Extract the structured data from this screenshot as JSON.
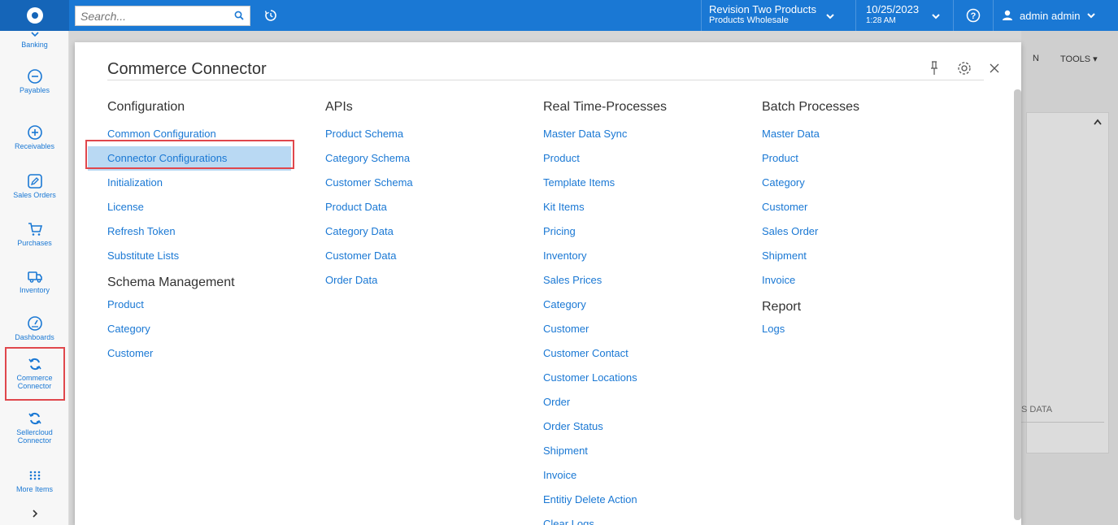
{
  "topbar": {
    "search_placeholder": "Search...",
    "branch_name": "Revision Two Products",
    "branch_sub": "Products Wholesale",
    "date": "10/25/2023",
    "time": "1:28 AM",
    "user": "admin admin"
  },
  "leftnav": {
    "items": [
      {
        "label": "Banking",
        "icon": "banking-icon"
      },
      {
        "label": "Payables",
        "icon": "minus-circle-icon"
      },
      {
        "label": "Receivables",
        "icon": "plus-circle-icon"
      },
      {
        "label": "Sales Orders",
        "icon": "pencil-icon"
      },
      {
        "label": "Purchases",
        "icon": "cart-icon"
      },
      {
        "label": "Inventory",
        "icon": "truck-icon"
      },
      {
        "label": "Dashboards",
        "icon": "gauge-icon"
      },
      {
        "label": "Commerce Connector",
        "icon": "sync-icon"
      },
      {
        "label": "Sellercloud Connector",
        "icon": "sync-icon"
      },
      {
        "label": "More Items",
        "icon": "grid-icon"
      }
    ]
  },
  "workspace": {
    "tab_partial": "N",
    "tools_label": "TOOLS",
    "data_label": "S DATA"
  },
  "panel": {
    "title": "Commerce Connector",
    "columns": [
      {
        "heading": "Configuration",
        "links": [
          "Common Configuration",
          "Connector Configurations",
          "Initialization",
          "License",
          "Refresh Token",
          "Substitute Lists"
        ],
        "heading2": "Schema Management",
        "links2": [
          "Product",
          "Category",
          "Customer"
        ]
      },
      {
        "heading": "APIs",
        "links": [
          "Product Schema",
          "Category Schema",
          "Customer Schema",
          "Product Data",
          "Category Data",
          "Customer Data",
          "Order Data"
        ]
      },
      {
        "heading": "Real Time-Processes",
        "links": [
          "Master Data Sync",
          "Product",
          "Template Items",
          "Kit Items",
          "Pricing",
          "Inventory",
          "Sales Prices",
          "Category",
          "Customer",
          "Customer Contact",
          "Customer Locations",
          "Order",
          "Order Status",
          "Shipment",
          "Invoice",
          "Entitiy Delete Action",
          "Clear Logs"
        ]
      },
      {
        "heading": "Batch Processes",
        "links": [
          "Master Data",
          "Product",
          "Category",
          "Customer",
          "Sales Order",
          "Shipment",
          "Invoice"
        ],
        "heading2": "Report",
        "links2": [
          "Logs"
        ]
      }
    ]
  }
}
